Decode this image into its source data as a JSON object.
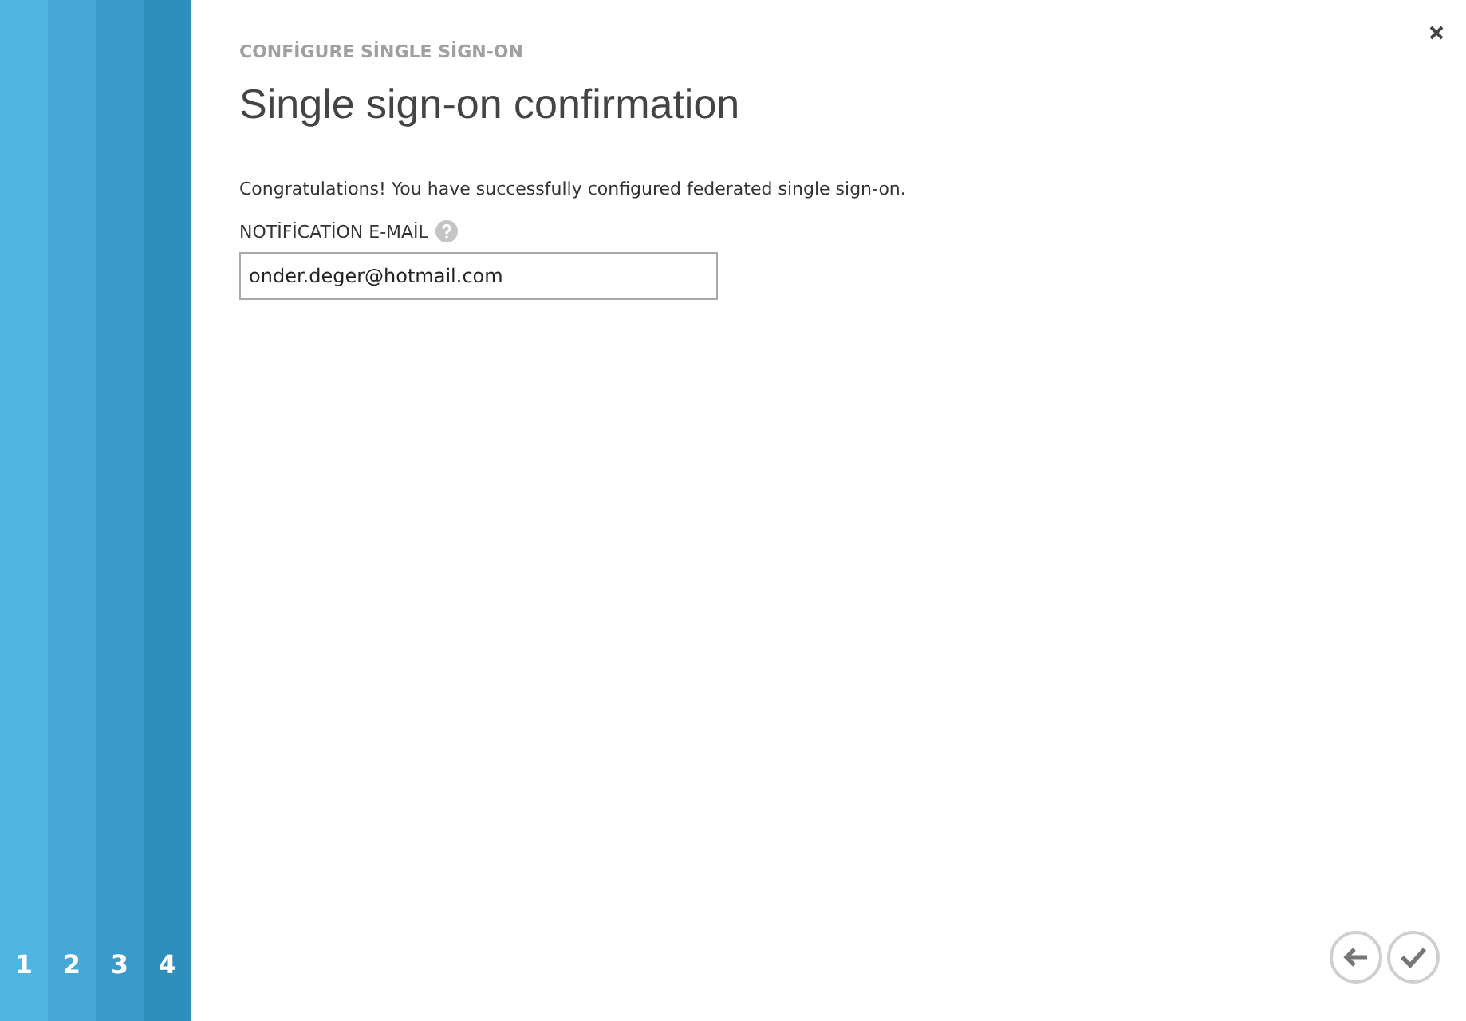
{
  "steps": [
    {
      "label": "1",
      "color": "#4fb4e0"
    },
    {
      "label": "2",
      "color": "#45a8d6"
    },
    {
      "label": "3",
      "color": "#3a9bcb"
    },
    {
      "label": "4",
      "color": "#2e8fbd"
    }
  ],
  "wizard": {
    "section": "CONFİGURE SİNGLE SİGN-ON",
    "title": "Single sign-on confirmation",
    "message": "Congratulations! You have successfully configured federated single sign-on.",
    "field": {
      "label": "NOTİFİCATİON E-MAİL",
      "value": "onder.deger@hotmail.com"
    }
  }
}
